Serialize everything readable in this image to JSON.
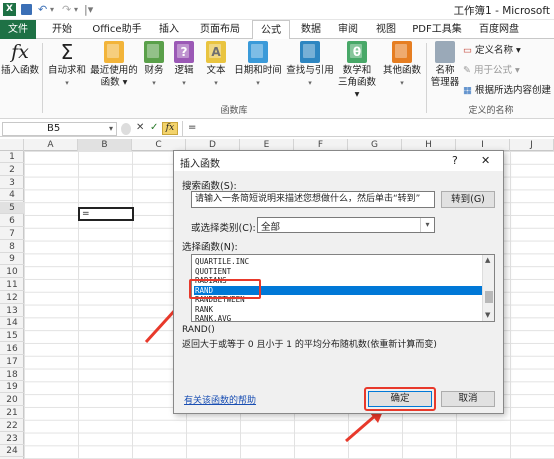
{
  "window": {
    "title": "工作簿1 - Microsoft"
  },
  "quick_access": {
    "undo_glyph": "↶",
    "redo_glyph": "↷",
    "dropdown_glyph": "▾"
  },
  "tabs": [
    {
      "label": "文件"
    },
    {
      "label": "开始"
    },
    {
      "label": "Office助手"
    },
    {
      "label": "插入"
    },
    {
      "label": "页面布局"
    },
    {
      "label": "公式"
    },
    {
      "label": "数据"
    },
    {
      "label": "审阅"
    },
    {
      "label": "视图"
    },
    {
      "label": "PDF工具集"
    },
    {
      "label": "百度网盘"
    }
  ],
  "ribbon": {
    "insert_function": {
      "icon_text": "fx",
      "label": "插入函数"
    },
    "autosum": {
      "icon_text": "Σ",
      "label": "自动求和"
    },
    "recent": {
      "line1": "最近使用的",
      "line2": "函数"
    },
    "finance": {
      "label": "财务"
    },
    "logical": {
      "label": "逻辑",
      "icon_text": "?"
    },
    "text": {
      "label": "文本",
      "icon_text": "A"
    },
    "datetime": {
      "label": "日期和时间"
    },
    "lookup": {
      "label": "查找与引用"
    },
    "math": {
      "line1": "数学和",
      "line2": "三角函数",
      "icon_text": "θ"
    },
    "other": {
      "label": "其他函数"
    },
    "group_library": "函数库",
    "name_manager": {
      "line1": "名称",
      "line2": "管理器"
    },
    "define_name": "定义名称",
    "use_in_formula": "用于公式",
    "create_from_selection": "根据所选内容创建",
    "group_names": "定义的名称"
  },
  "formula_bar": {
    "name_box": "B5",
    "cancel": "✕",
    "enter": "✓",
    "fx": "fx",
    "content": "="
  },
  "sheet": {
    "columns": [
      "A",
      "B",
      "C",
      "D",
      "E",
      "F",
      "G",
      "H",
      "I",
      "J"
    ],
    "rows": [
      "1",
      "2",
      "3",
      "4",
      "5",
      "6",
      "7",
      "8",
      "9",
      "10",
      "11",
      "12",
      "13",
      "14",
      "15",
      "16",
      "17",
      "18",
      "19",
      "20",
      "21",
      "22",
      "23",
      "24"
    ],
    "active_cell_value": "="
  },
  "dialog": {
    "title": "插入函数",
    "help_glyph": "?",
    "close_glyph": "✕",
    "search_label": "搜索函数(S):",
    "search_value": "请输入一条简短说明来描述您想做什么，然后单击“转到”",
    "go_button": "转到(G)",
    "category_label": "或选择类别(C):",
    "category_value": "全部",
    "select_label": "选择函数(N):",
    "functions": [
      "QUARTILE.INC",
      "QUOTIENT",
      "RADIANS",
      "RAND",
      "RANDBETWEEN",
      "RANK",
      "RANK.AVG"
    ],
    "selected_function": "RAND",
    "signature": "RAND()",
    "description": "返回大于或等于 0 且小于 1 的平均分布随机数(依重新计算而变)",
    "help_link": "有关该函数的帮助",
    "ok_button": "确定",
    "cancel_button": "取消"
  },
  "colors": {
    "accent_green": "#1e7145",
    "highlight_red": "#e8392b",
    "selection_blue": "#0078d7"
  }
}
